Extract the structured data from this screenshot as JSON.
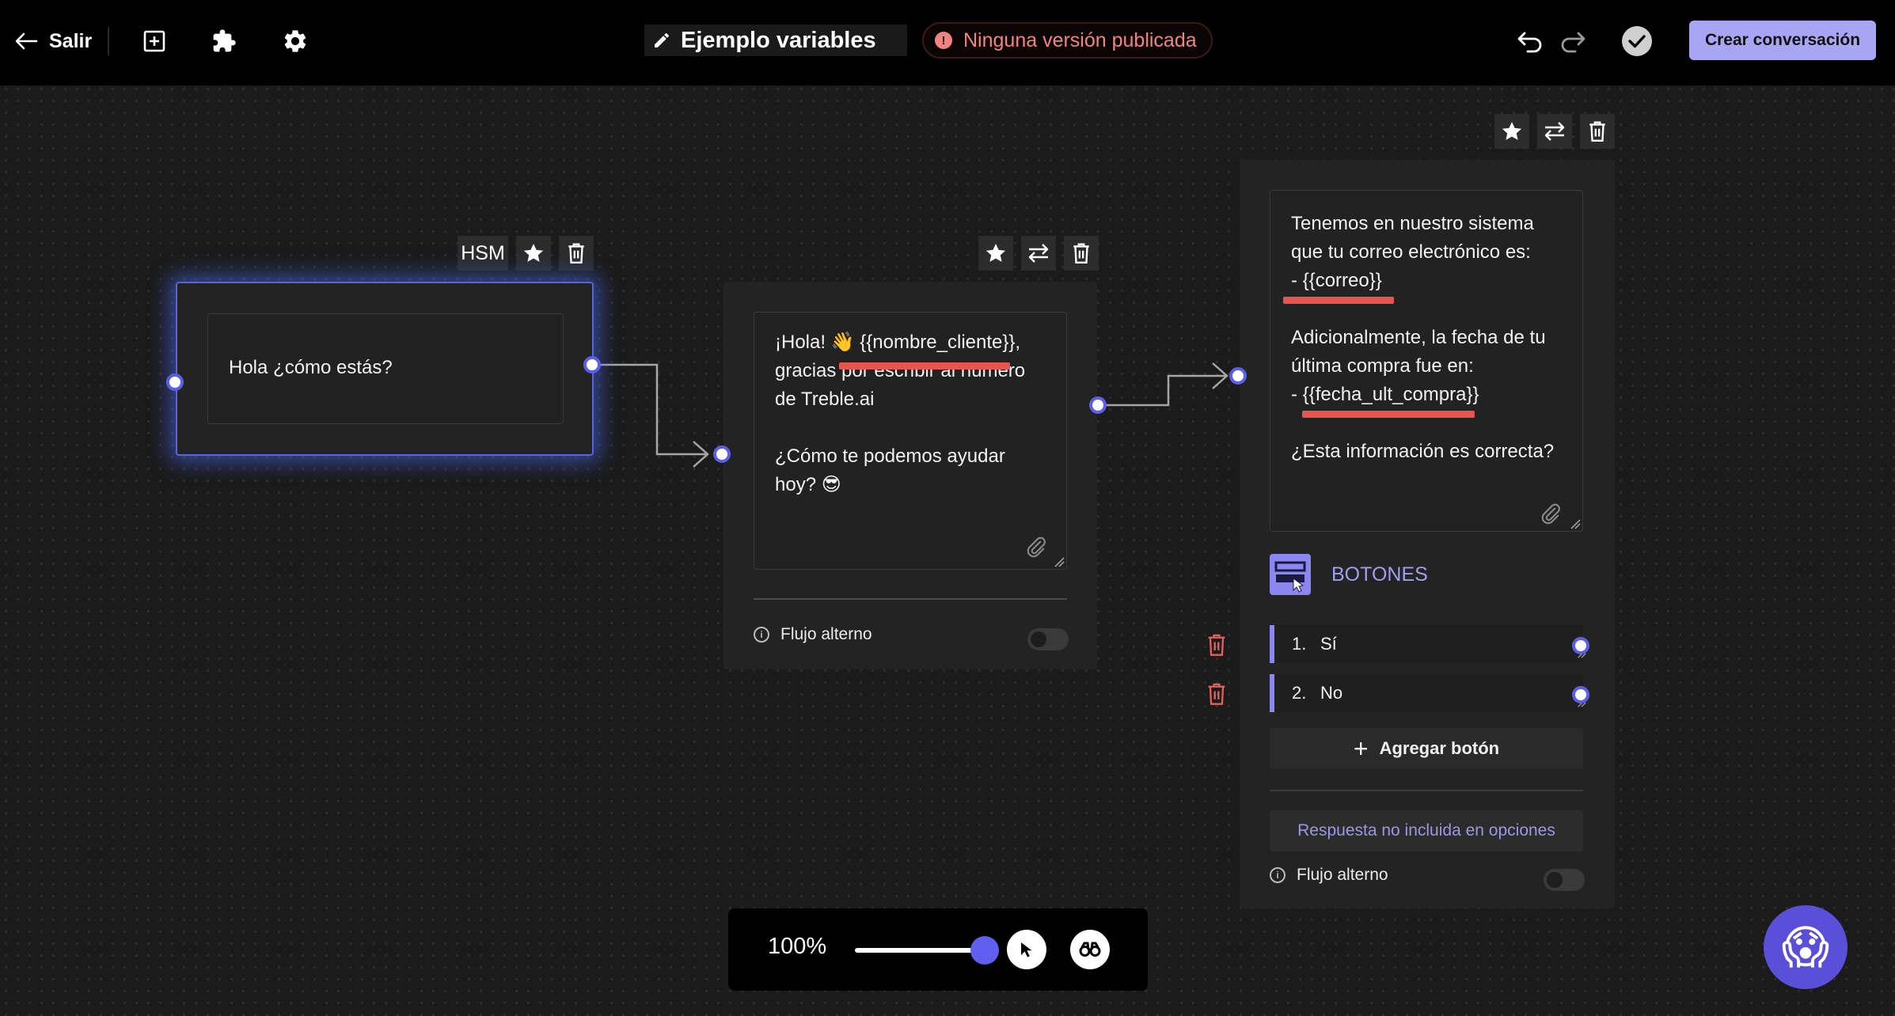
{
  "topbar": {
    "back_label": "Salir",
    "flow_title": "Ejemplo variables",
    "status_text": "Ninguna versión publicada",
    "create_button": "Crear conversación",
    "icons": [
      "arrow-left-icon",
      "add-box-icon",
      "puzzle-icon",
      "gear-icon",
      "pencil-icon",
      "alert-icon",
      "undo-icon",
      "redo-icon",
      "check-circle-icon"
    ]
  },
  "nodes": {
    "hsm": {
      "tag": "HSM",
      "message": "Hola ¿cómo estás?"
    },
    "welcome": {
      "message": "¡Hola! 👋 {{nombre_cliente}},\ngracias por escribir al número\nde Treble.ai\n\n¿Cómo te podemos ayudar\nhoy? 😎",
      "alt_flow_label": "Flujo alterno"
    },
    "confirm": {
      "message": "Tenemos en nuestro sistema\nque tu correo electrónico es:\n- {{correo}}\n\nAdicionalmente, la fecha de tu\núltima compra fue en:\n- {{fecha_ult_compra}}\n\n¿Esta información es correcta?",
      "buttons_header": "BOTONES",
      "buttons": [
        {
          "num": "1.",
          "label": "Sí"
        },
        {
          "num": "2.",
          "label": "No"
        }
      ],
      "add_button_label": "Agregar botón",
      "fallback_placeholder": "Respuesta no incluida en opciones",
      "alt_flow_label": "Flujo alterno"
    }
  },
  "zoom": {
    "value_label": "100%",
    "level": 1.0
  },
  "colors": {
    "accent": "#5b5fe8",
    "primary_button": "#a8a6f4",
    "highlight": "#e8554f",
    "status": "#f0847f"
  }
}
